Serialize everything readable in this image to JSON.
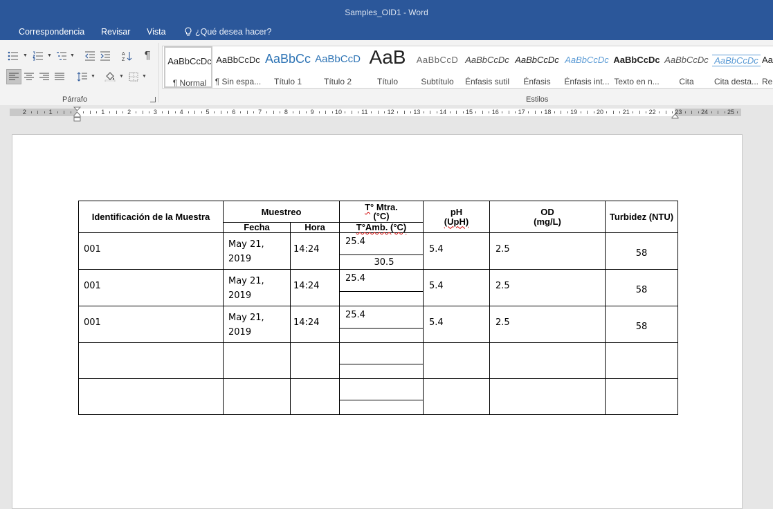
{
  "window": {
    "title": "Samples_OID1 - Word"
  },
  "tabs": [
    {
      "label": "Correspondencia"
    },
    {
      "label": "Revisar"
    },
    {
      "label": "Vista"
    }
  ],
  "tellme": {
    "label": "¿Qué desea hacer?"
  },
  "ribbon": {
    "paragraph_group": "Párrafo",
    "styles_group": "Estilos"
  },
  "styles": [
    {
      "sample": "AaBbCcDc",
      "name": "¶ Normal"
    },
    {
      "sample": "AaBbCcDc",
      "name": "¶ Sin espa..."
    },
    {
      "sample": "AaBbCc",
      "name": "Título 1"
    },
    {
      "sample": "AaBbCcD",
      "name": "Título 2"
    },
    {
      "sample": "AaB",
      "name": "Título"
    },
    {
      "sample": "AaBbCcD",
      "name": "Subtítulo"
    },
    {
      "sample": "AaBbCcDc",
      "name": "Énfasis sutil"
    },
    {
      "sample": "AaBbCcDc",
      "name": "Énfasis"
    },
    {
      "sample": "AaBbCcDc",
      "name": "Énfasis int..."
    },
    {
      "sample": "AaBbCcDc",
      "name": "Texto en n..."
    },
    {
      "sample": "AaBbCcDc",
      "name": "Cita"
    },
    {
      "sample": "AaBbCcDc",
      "name": "Cita desta..."
    },
    {
      "sample": "AaBbCcDc",
      "name": "Re"
    }
  ],
  "ruler": {
    "labels_left": [
      "2",
      "1"
    ],
    "labels_right": [
      "1",
      "2",
      "3",
      "4",
      "5",
      "6",
      "7",
      "8",
      "9",
      "10",
      "11",
      "12",
      "13",
      "14",
      "15",
      "16",
      "17",
      "18",
      "19",
      "20",
      "21",
      "22",
      "23",
      "24",
      "25"
    ]
  },
  "table": {
    "headers": {
      "id": "Identificación de la Muestra",
      "sampling": "Muestreo",
      "date": "Fecha",
      "time": "Hora",
      "temp_sample": "T° Mtra.",
      "temp_sample_unit": "(°C)",
      "temp_amb": "T°Amb.  (°C)",
      "ph": "pH",
      "ph_unit": "(UpH)",
      "od": "OD",
      "od_unit": "(mg/L)",
      "turbidity": "Turbidez (NTU)"
    },
    "rows": [
      {
        "id": "001",
        "date_line1": "May 21,",
        "date_line2": "2019",
        "time": "14:24",
        "temp_sample": "25.4",
        "temp_amb": "30.5",
        "ph": "5.4",
        "od": "2.5",
        "turbidity": "58"
      },
      {
        "id": "001",
        "date_line1": "May 21,",
        "date_line2": "2019",
        "time": "14:24",
        "temp_sample": "25.4",
        "temp_amb": "",
        "ph": "5.4",
        "od": "2.5",
        "turbidity": "58"
      },
      {
        "id": "001",
        "date_line1": "May 21,",
        "date_line2": "2019",
        "time": "14:24",
        "temp_sample": "25.4",
        "temp_amb": "",
        "ph": "5.4",
        "od": "2.5",
        "turbidity": "58"
      },
      {
        "id": "",
        "date_line1": "",
        "date_line2": "",
        "time": "",
        "temp_sample": "",
        "temp_amb": "",
        "ph": "",
        "od": "",
        "turbidity": ""
      },
      {
        "id": "",
        "date_line1": "",
        "date_line2": "",
        "time": "",
        "temp_sample": "",
        "temp_amb": "",
        "ph": "",
        "od": "",
        "turbidity": ""
      }
    ]
  }
}
